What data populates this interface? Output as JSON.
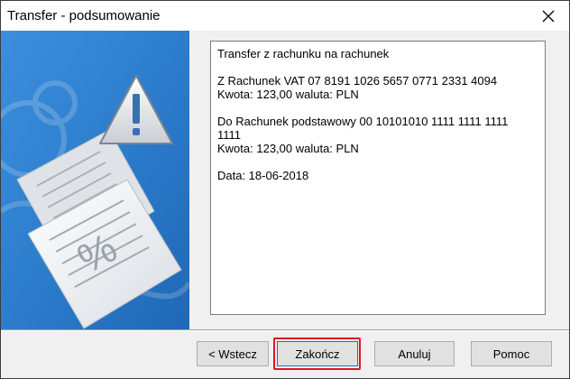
{
  "window": {
    "title": "Transfer - podsumowanie"
  },
  "summary": {
    "lines": [
      "Transfer z rachunku na rachunek",
      "",
      "Z Rachunek VAT 07 8191 1026 5657 0771 2331 4094",
      "Kwota: 123,00 waluta: PLN",
      "",
      "Do Rachunek podstawowy 00 10101010 1111 1111 1111",
      "1111",
      "Kwota: 123,00 waluta: PLN",
      "",
      "Data: 18-06-2018"
    ]
  },
  "buttons": {
    "back": "< Wstecz",
    "finish": "Zakończ",
    "cancel": "Anuluj",
    "help": "Pomoc"
  },
  "colors": {
    "side_panel_blue": "#2a7fd0",
    "highlight_red": "#e0191a",
    "default_button_border": "#0078d7"
  },
  "icons": {
    "close": "close-icon",
    "warning": "warning-triangle-icon",
    "documents": "documents-icon"
  }
}
